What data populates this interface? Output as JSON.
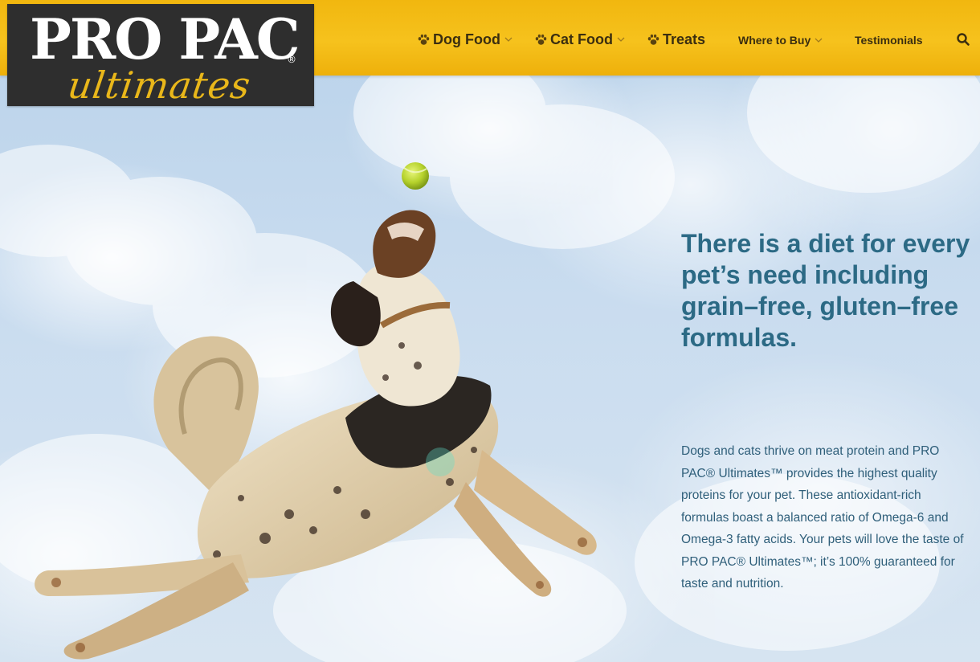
{
  "brand": {
    "name": "PRO PAC",
    "registered": "®",
    "script": "ultimates",
    "logo_bg": "#2e2e2e",
    "script_color": "#e9b71a"
  },
  "nav": {
    "items": [
      {
        "label": "Dog Food",
        "icon": "paw-icon",
        "has_dropdown": true
      },
      {
        "label": "Cat Food",
        "icon": "paw-icon",
        "has_dropdown": true
      },
      {
        "label": "Treats",
        "icon": "paw-icon",
        "has_dropdown": false
      },
      {
        "label": "Where to Buy",
        "has_dropdown": true
      },
      {
        "label": "Testimonials",
        "has_dropdown": false
      }
    ],
    "search_icon": "search-icon",
    "bar_color": "#f3bb14",
    "text_color": "#3b2e10"
  },
  "hero": {
    "headline": "There is a diet for every pet’s need including grain–free, gluten–free formulas.",
    "body": "Dogs and cats thrive on meat protein and PRO PAC® Ultimates™ provides the highest quality proteins for your pet. These antioxidant-rich formulas boast a balanced ratio of Omega-6 and Omega-3 fatty acids. Your pets will love the taste of PRO PAC® Ultimates™; it’s 100% guaranteed for taste and nutrition.",
    "headline_color": "#2c6a85",
    "body_color": "#2f5f7a",
    "image": "dog-jumping-for-tennis-ball-in-sky"
  }
}
